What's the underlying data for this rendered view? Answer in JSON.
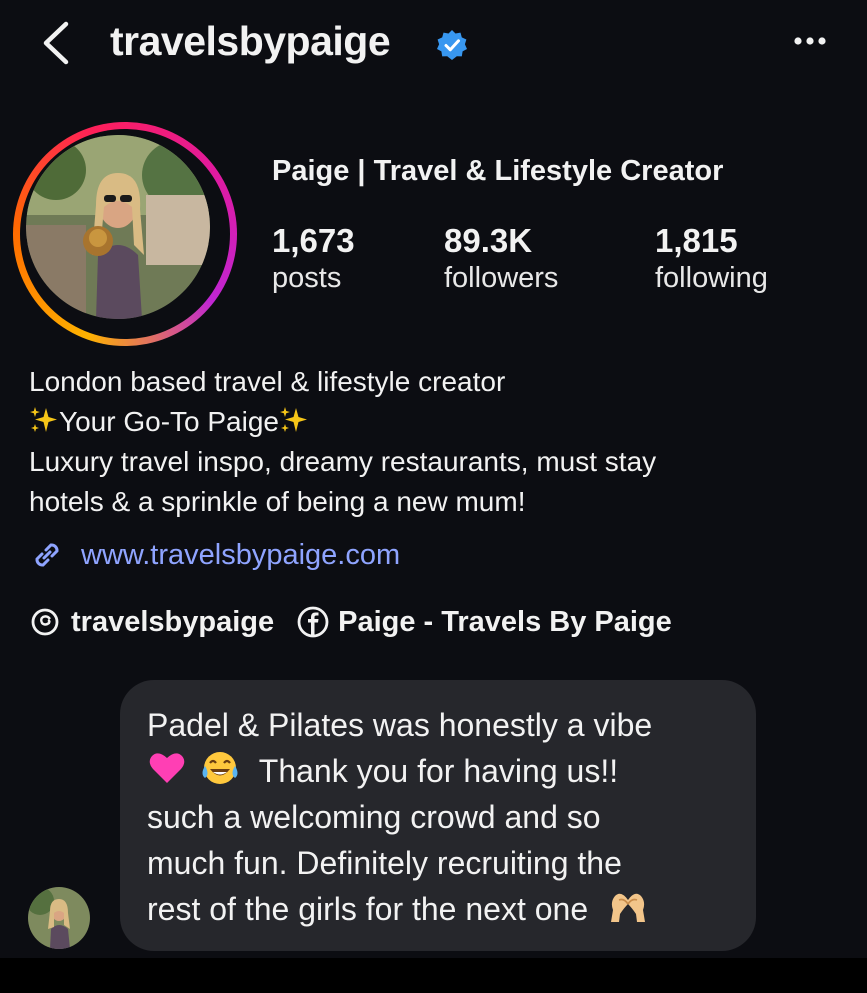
{
  "header": {
    "username": "travelsbypaige",
    "verified": true,
    "icons": [
      "chevron-left-icon",
      "verified-badge-icon",
      "more-options-icon"
    ],
    "accent_color": "#3897f0"
  },
  "profile": {
    "display_name": "Paige | Travel & Lifestyle Creator",
    "stats": [
      {
        "value": "1,673",
        "label": "posts"
      },
      {
        "value": "89.3K",
        "label": "followers"
      },
      {
        "value": "1,815",
        "label": "following"
      }
    ],
    "story_ring_colors": [
      "#ffb300",
      "#ff1f5a",
      "#c026d3"
    ]
  },
  "bio": {
    "line1": "London based travel & lifestyle creator",
    "line2": "Your Go-To Paige",
    "line3": "Luxury travel inspo, dreamy restaurants, must stay",
    "line4": "hotels & a sprinkle of being a new mum!",
    "emoji": "sparkles"
  },
  "links": {
    "website": "www.travelsbypaige.com",
    "threads": "travelsbypaige",
    "facebook": "Paige - Travels By Paige",
    "link_color": "#8fa4ff"
  },
  "message": {
    "line1": "Padel & Pilates was honestly a vibe",
    "line2": "Thank you for having us!!",
    "line3": "such a welcoming crowd and so",
    "line4": "much fun. Definitely recruiting the",
    "line5": "rest of the girls for the next one",
    "emojis": [
      "pink-heart",
      "tears-of-joy",
      "heart-hands"
    ],
    "bubble_color": "#26272c"
  }
}
